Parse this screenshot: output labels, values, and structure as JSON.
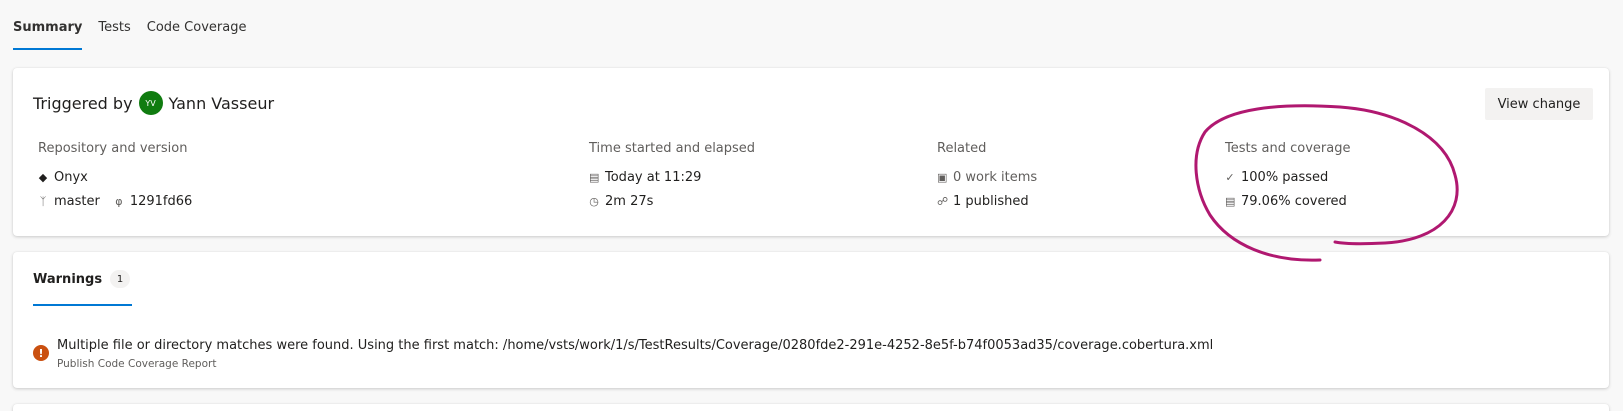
{
  "tabs": [
    {
      "label": "Summary",
      "active": true
    },
    {
      "label": "Tests"
    },
    {
      "label": "Code Coverage"
    }
  ],
  "summary": {
    "triggered_by_label": "Triggered by",
    "avatar_initials": "YV",
    "user_name": "Yann Vasseur",
    "view_change_label": "View change",
    "repository": {
      "heading": "Repository and version",
      "repo_name": "Onyx",
      "branch": "master",
      "commit": "1291fd66"
    },
    "time": {
      "heading": "Time started and elapsed",
      "started": "Today at 11:29",
      "elapsed": "2m 27s"
    },
    "related": {
      "heading": "Related",
      "work_items": "0 work items",
      "published": "1 published"
    },
    "tests": {
      "heading": "Tests and coverage",
      "passed": "100% passed",
      "covered": "79.06% covered"
    }
  },
  "warnings": {
    "tab_label": "Warnings",
    "count": "1",
    "message": "Multiple file or directory matches were found. Using the first match: /home/vsts/work/1/s/TestResults/Coverage/0280fde2-291e-4252-8e5f-b74f0053ad35/coverage.cobertura.xml",
    "source": "Publish Code Coverage Report"
  },
  "colors": {
    "accent": "#0078d4",
    "avatar": "#107c10",
    "warning": "#ca5010",
    "annotation": "#b01870"
  }
}
